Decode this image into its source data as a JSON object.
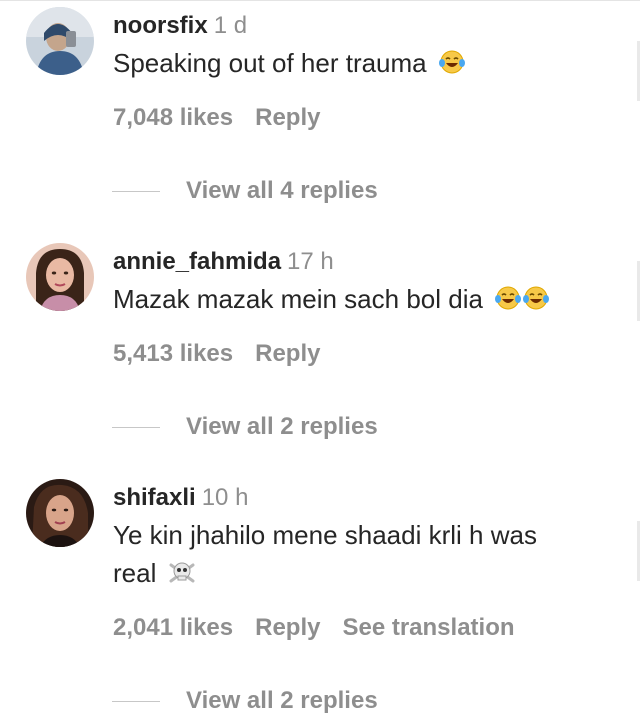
{
  "comments": [
    {
      "username": "noorsfix",
      "time": "1 d",
      "text": "Speaking out of her trauma",
      "emoji": [
        "face-with-tears-of-joy"
      ],
      "likes": "7,048 likes",
      "reply": "Reply",
      "view_replies": "View all 4 replies"
    },
    {
      "username": "annie_fahmida",
      "time": "17 h",
      "text": "Mazak mazak mein sach bol dia",
      "emoji": [
        "face-with-tears-of-joy",
        "face-with-tears-of-joy"
      ],
      "likes": "5,413 likes",
      "reply": "Reply",
      "view_replies": "View all 2 replies"
    },
    {
      "username": "shifaxli",
      "time": "10 h",
      "text_line1": "Ye kin jhahilo mene shaadi krli h was",
      "text_line2": "real",
      "emoji": [
        "skull-and-crossbones"
      ],
      "likes": "2,041 likes",
      "reply": "Reply",
      "see_translation": "See translation",
      "view_replies": "View all 2 replies"
    }
  ]
}
